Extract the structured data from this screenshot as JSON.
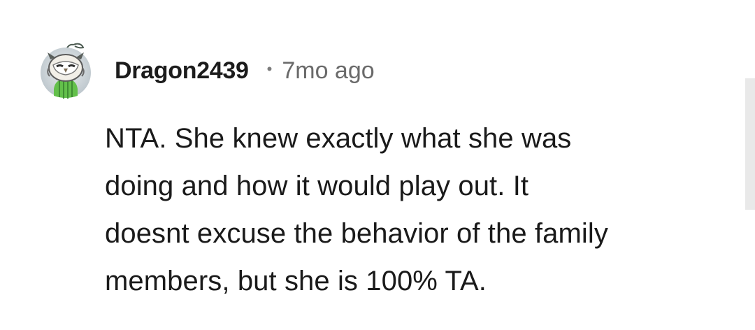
{
  "comment": {
    "author": "Dragon2439",
    "separator": "•",
    "time_ago": "7mo ago",
    "avatar_icon": "owl-avatar-icon",
    "body": "NTA. She knew exactly what she was\ndoing and how it would play out. It\ndoesnt excuse the behavior of the family\nmembers, but she is 100% TA."
  },
  "colors": {
    "background": "#ffffff",
    "username": "#1c1c1c",
    "meta": "#6a6a6a",
    "body": "#1a1a1a",
    "scrollbar": "#e9e9e9"
  }
}
